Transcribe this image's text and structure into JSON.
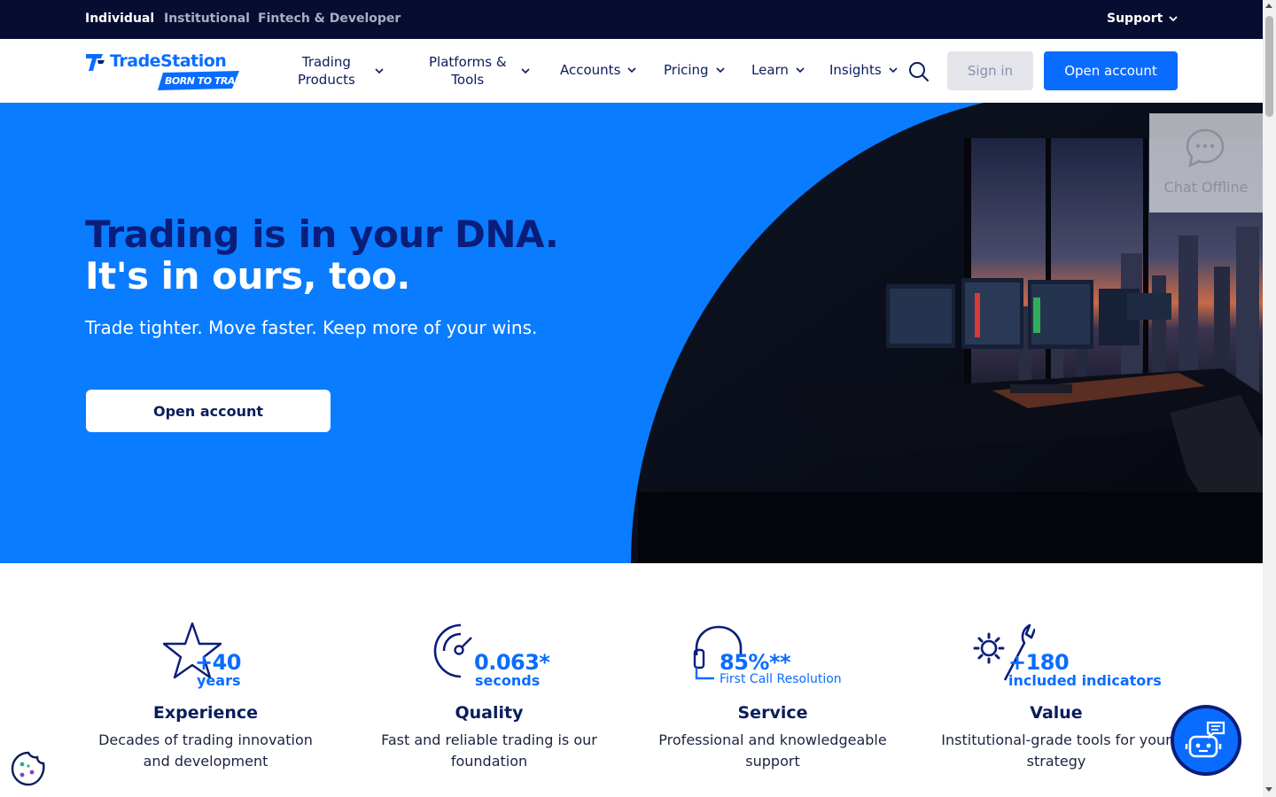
{
  "topbar": {
    "audiences": [
      "Individual",
      "Institutional",
      "Fintech & Developer"
    ],
    "support": "Support"
  },
  "brand": {
    "name": "TradeStation",
    "tagline": "BORN TO TRADE"
  },
  "nav": {
    "items": [
      {
        "line1": "Trading",
        "line2": "Products"
      },
      {
        "line1": "Platforms &",
        "line2": "Tools"
      },
      {
        "line1": "Accounts",
        "line2": ""
      },
      {
        "line1": "Pricing",
        "line2": ""
      },
      {
        "line1": "Learn",
        "line2": ""
      },
      {
        "line1": "Insights",
        "line2": ""
      }
    ],
    "sign_in": "Sign in",
    "open_account": "Open account"
  },
  "hero": {
    "headline_1": "Trading is in your DNA.",
    "headline_2": "It's in ours, too.",
    "subheadline": "Trade tighter. Move faster. Keep more of your wins.",
    "cta": "Open account"
  },
  "chat": {
    "status": "Chat Offline"
  },
  "features": [
    {
      "stat": "+40",
      "unit": "years",
      "title": "Experience",
      "desc_1": "Decades of trading innovation",
      "desc_2": "and development",
      "icon": "star-icon"
    },
    {
      "stat": "0.063*",
      "unit": "seconds",
      "title": "Quality",
      "desc_1": "Fast and reliable trading is our",
      "desc_2": "foundation",
      "icon": "speedometer-icon"
    },
    {
      "stat": "85%**",
      "unit": "First Call Resolution",
      "title": "Service",
      "desc_1": "Professional and knowledgeable",
      "desc_2": "support",
      "icon": "headset-icon"
    },
    {
      "stat": "+180",
      "unit": "included indicators",
      "title": "Value",
      "desc_1": "Institutional-grade tools for your",
      "desc_2": "strategy",
      "icon": "gear-wrench-icon"
    }
  ],
  "colors": {
    "accent": "#0a6cff",
    "hero_blue": "#0a7cff",
    "navy": "#0a1d5c",
    "topbar": "#060d30"
  }
}
